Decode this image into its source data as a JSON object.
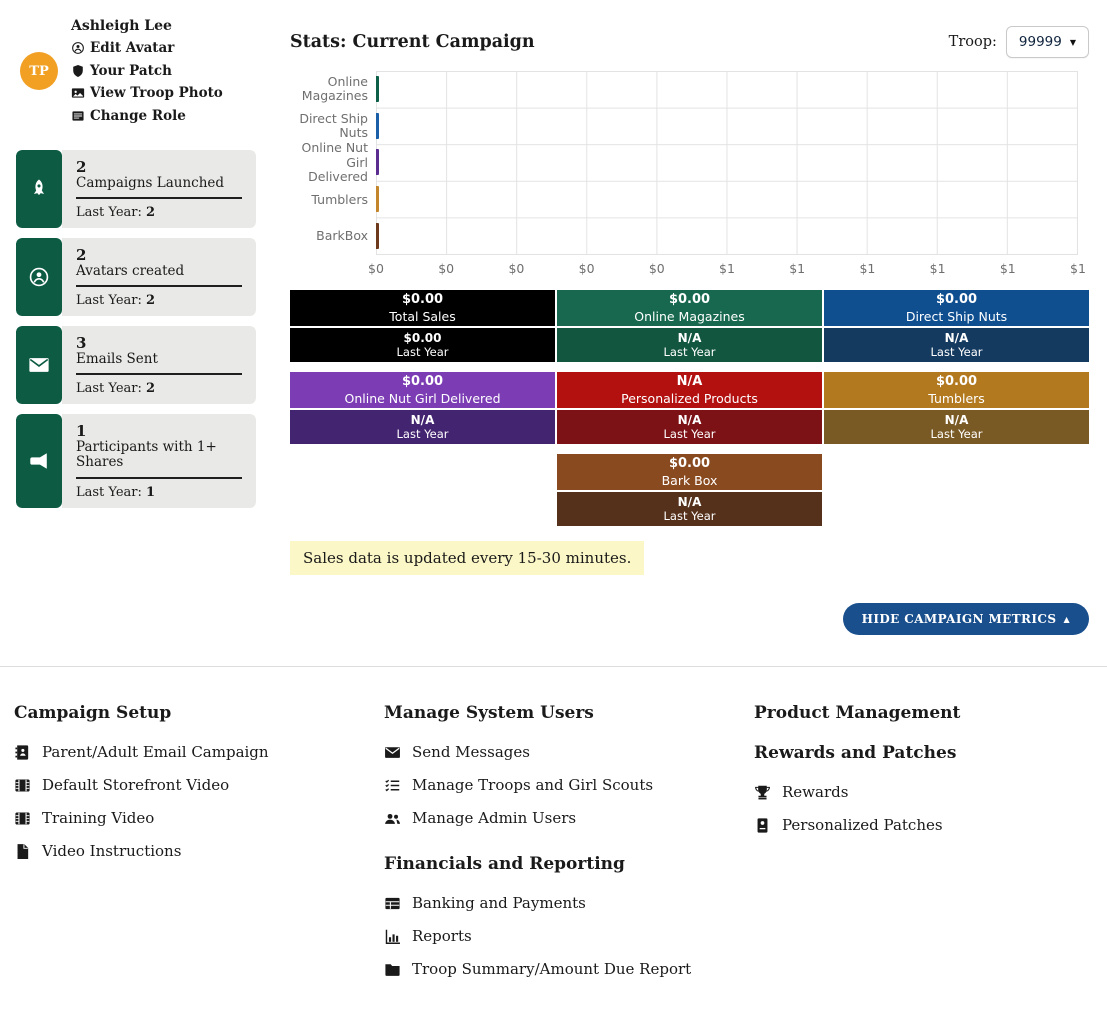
{
  "profile": {
    "avatar_initials": "TP",
    "name": "Ashleigh Lee",
    "links": [
      {
        "label": "Edit Avatar",
        "icon": "person-circle-icon"
      },
      {
        "label": "Your Patch",
        "icon": "shield-icon"
      },
      {
        "label": "View Troop Photo",
        "icon": "photo-icon"
      },
      {
        "label": "Change Role",
        "icon": "list-icon"
      }
    ]
  },
  "stat_cards": [
    {
      "value": "2",
      "label": "Campaigns Launched",
      "last_year_label": "Last Year:",
      "last_year_value": "2",
      "icon": "rocket-icon"
    },
    {
      "value": "2",
      "label": "Avatars created",
      "last_year_label": "Last Year:",
      "last_year_value": "2",
      "icon": "person-circle-icon"
    },
    {
      "value": "3",
      "label": "Emails Sent",
      "last_year_label": "Last Year:",
      "last_year_value": "2",
      "icon": "envelope-icon"
    },
    {
      "value": "1",
      "label": "Participants with 1+ Shares",
      "last_year_label": "Last Year:",
      "last_year_value": "1",
      "icon": "megaphone-icon"
    }
  ],
  "main": {
    "title": "Stats: Current Campaign",
    "troop_label": "Troop:",
    "troop_value": "99999",
    "note": "Sales data is updated every 15-30 minutes.",
    "hide_button_label": "HIDE CAMPAIGN METRICS",
    "hide_button_caret": "▲"
  },
  "chart_data": {
    "type": "bar",
    "orientation": "horizontal",
    "title": "",
    "xlabel": "",
    "ylabel": "",
    "categories": [
      "Online Magazines",
      "Direct Ship Nuts",
      "Online Nut Girl Delivered",
      "Tumblers",
      "BarkBox"
    ],
    "values": [
      0,
      0,
      0,
      0,
      0
    ],
    "bar_colors": [
      "#0e5f48",
      "#1b5fa8",
      "#5c2d91",
      "#c4862c",
      "#6e3a1e"
    ],
    "xlim": [
      0,
      1
    ],
    "x_tick_labels": [
      "$0",
      "$0",
      "$0",
      "$0",
      "$0",
      "$1",
      "$1",
      "$1",
      "$1",
      "$1",
      "$1"
    ],
    "grid": true,
    "legend": false
  },
  "tiles": [
    {
      "value": "$0.00",
      "label": "Total Sales",
      "last_value": "$0.00",
      "last_label": "Last Year",
      "color": "#000000",
      "last_color": "#000000"
    },
    {
      "value": "$0.00",
      "label": "Online Magazines",
      "last_value": "N/A",
      "last_label": "Last Year",
      "color": "#17684e",
      "last_color": "#125640"
    },
    {
      "value": "$0.00",
      "label": "Direct Ship Nuts",
      "last_value": "N/A",
      "last_label": "Last Year",
      "color": "#0f4f90",
      "last_color": "#143a60"
    },
    {
      "value": "$0.00",
      "label": "Online Nut Girl Delivered",
      "last_value": "N/A",
      "last_label": "Last Year",
      "color": "#7b3cb4",
      "last_color": "#432470"
    },
    {
      "value": "N/A",
      "label": "Personalized Products",
      "last_value": "N/A",
      "last_label": "Last Year",
      "color": "#b31010",
      "last_color": "#7c1116"
    },
    {
      "value": "$0.00",
      "label": "Tumblers",
      "last_value": "N/A",
      "last_label": "Last Year",
      "color": "#b2791f",
      "last_color": "#7a5a24"
    },
    {
      "value": "$0.00",
      "label": "Bark Box",
      "last_value": "N/A",
      "last_label": "Last Year",
      "color": "#8a4a20",
      "last_color": "#55301b"
    }
  ],
  "footer": {
    "columns": [
      {
        "sections": [
          {
            "heading": "Campaign Setup",
            "links": [
              {
                "label": "Parent/Adult Email Campaign",
                "icon": "address-book-icon"
              },
              {
                "label": "Default Storefront Video",
                "icon": "film-icon"
              },
              {
                "label": "Training Video",
                "icon": "film-icon"
              },
              {
                "label": "Video Instructions",
                "icon": "file-icon"
              }
            ]
          }
        ]
      },
      {
        "sections": [
          {
            "heading": "Manage System Users",
            "links": [
              {
                "label": "Send Messages",
                "icon": "envelope-icon"
              },
              {
                "label": "Manage Troops and Girl Scouts",
                "icon": "checklist-icon"
              },
              {
                "label": "Manage Admin Users",
                "icon": "people-icon"
              }
            ]
          },
          {
            "heading": "Financials and Reporting",
            "links": [
              {
                "label": "Banking and Payments",
                "icon": "table-icon"
              },
              {
                "label": "Reports",
                "icon": "bar-chart-icon"
              },
              {
                "label": "Troop Summary/Amount Due Report",
                "icon": "folder-icon"
              }
            ]
          }
        ]
      },
      {
        "sections": [
          {
            "heading": "Product Management",
            "links": []
          },
          {
            "heading": "Rewards and Patches",
            "links": [
              {
                "label": "Rewards",
                "icon": "trophy-icon"
              },
              {
                "label": "Personalized Patches",
                "icon": "patch-icon"
              }
            ]
          }
        ]
      }
    ]
  },
  "theme": {
    "accent_green": "#0d5b43",
    "accent_blue": "#194f8d",
    "avatar_orange": "#f2a024",
    "note_yellow": "#fbf7c6",
    "card_gray": "#e9e9e7"
  }
}
